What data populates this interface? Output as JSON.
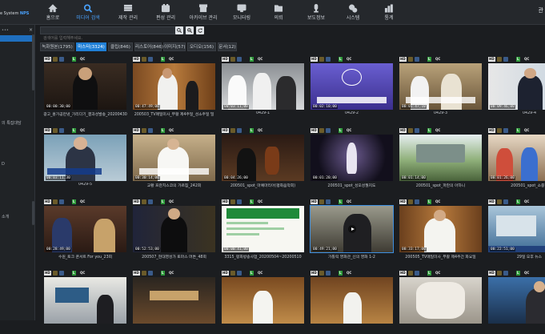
{
  "brand": {
    "prefix": "e System ",
    "highlight": "NPS"
  },
  "nav": [
    {
      "label": "홈으로",
      "icon": "home-icon",
      "active": false
    },
    {
      "label": "미디어 검색",
      "icon": "search-icon",
      "active": true
    },
    {
      "label": "제작 관리",
      "icon": "list-icon",
      "active": false
    },
    {
      "label": "편성 관리",
      "icon": "calendar-icon",
      "active": false
    },
    {
      "label": "아카이브 관리",
      "icon": "archive-icon",
      "active": false
    },
    {
      "label": "모니터링",
      "icon": "monitor-icon",
      "active": false
    },
    {
      "label": "의뢰",
      "icon": "folder-icon",
      "active": false
    },
    {
      "label": "보도정보",
      "icon": "microphone-icon",
      "active": false
    },
    {
      "label": "시스템",
      "icon": "gears-icon",
      "active": false
    },
    {
      "label": "통계",
      "icon": "chart-icon",
      "active": false
    }
  ],
  "top_right": "관",
  "sidebar": {
    "selected_label": "",
    "items": [
      "",
      "의 특집대담",
      "D",
      "소개"
    ]
  },
  "search": {
    "placeholder": "검색어를 입력해주세요."
  },
  "tabs": [
    {
      "label": "녹화원본(1795)",
      "active": false
    },
    {
      "label": "마스터(3324)",
      "active": true
    },
    {
      "label": "클립(846)",
      "active": false
    },
    {
      "label": "리스토어(846)",
      "active": false
    },
    {
      "label": "이미지(57)",
      "active": false
    },
    {
      "label": "오디오(156)",
      "active": false
    },
    {
      "label": "문서(12)",
      "active": false
    }
  ],
  "badges": {
    "hd": "HD",
    "l": "L",
    "qc": "QC"
  },
  "colors": {
    "accent": "#1f7fd6",
    "live": "#2e9a3a"
  },
  "cards": [
    {
      "title": "광고_홍가공만냉_가리다기_결과성발송_20200430",
      "timecode": "00:00:30;00",
      "scene": "priest-dark"
    },
    {
      "title": "200503_TV매일미사_부활 제4주일_성소주일 밀",
      "timecode": "00:47:49;00",
      "scene": "speaker-wood"
    },
    {
      "title": "0429-1",
      "timecode": "00:03:11;00",
      "scene": "nuns"
    },
    {
      "title": "0429-2",
      "timecode": "00:02:10;00",
      "scene": "caption-graphic"
    },
    {
      "title": "0429-3",
      "timecode": "00:01:47;10",
      "scene": "clergy"
    },
    {
      "title": "0429-4",
      "timecode": "00:09:46;00",
      "scene": "newsman"
    },
    {
      "title": "0429-5",
      "timecode": "00:03:11;30",
      "scene": "man-interview"
    },
    {
      "title": "교황 프란치스코의 가르침_242회",
      "timecode": "00:30:14;00",
      "scene": "pope"
    },
    {
      "title": "200501_spot_마예마리아(평화음악회)",
      "timecode": "00:04:26;00",
      "scene": "orchestra"
    },
    {
      "title": "200501_spot_성모성월지도",
      "timecode": "00:01:20;00",
      "scene": "statue"
    },
    {
      "title": "200501_spot_파란의 아하니",
      "timecode": "00:01:14;00",
      "scene": "garden"
    },
    {
      "title": "200501_spot_소중한",
      "timecode": "00:01:26;00",
      "scene": "children"
    },
    {
      "title": "수원_토크 콘서트 For you_23회",
      "timecode": "00:28:49;00",
      "scene": "talk-show"
    },
    {
      "title": "200507_현대영성가 토마스 머튼_48회",
      "timecode": "00:52:53;00",
      "scene": "dark-speaker"
    },
    {
      "title": "3315_평화방송사업_20200504~20200510",
      "timecode": "00:00:41;00",
      "scene": "green-doc"
    },
    {
      "title": "가톨릭 영화관_신의 영화 1-2",
      "timecode": "00:49:21;00",
      "scene": "film"
    },
    {
      "title": "200505_TV매일미사_부활 제4주간 화요일",
      "timecode": "00:33:17;00",
      "scene": "priest-white"
    },
    {
      "title": "29일 오후 뉴스",
      "timecode": "00:22:51;00",
      "scene": "news"
    },
    {
      "title": "",
      "timecode": "",
      "scene": "classroom"
    },
    {
      "title": "",
      "timecode": "",
      "scene": "stage"
    },
    {
      "title": "",
      "timecode": "",
      "scene": "altar"
    },
    {
      "title": "",
      "timecode": "",
      "scene": "altar2"
    },
    {
      "title": "",
      "timecode": "",
      "scene": "marble"
    },
    {
      "title": "",
      "timecode": "",
      "scene": "lecturer"
    }
  ]
}
